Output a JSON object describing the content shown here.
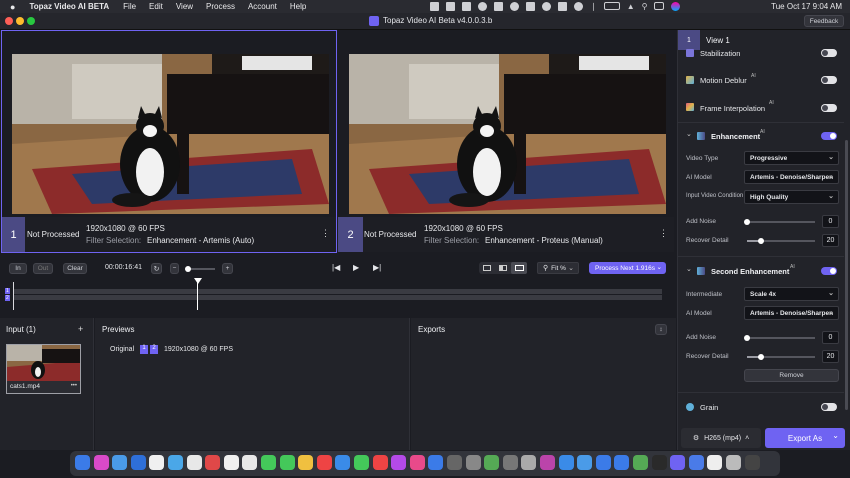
{
  "menubar": {
    "app_name": "Topaz Video AI BETA",
    "items": [
      "File",
      "Edit",
      "View",
      "Process",
      "Account",
      "Help"
    ],
    "clock": "Tue Oct 17  9:04 AM"
  },
  "window": {
    "title": "Topaz Video AI Beta  v4.0.0.3.b",
    "feedback_label": "Feedback"
  },
  "views": [
    {
      "number": "1",
      "status": "Not Processed",
      "resolution": "1920x1080 @ 60 FPS",
      "filter_label": "Filter Selection:",
      "filter_value": "Enhancement - Artemis (Auto)"
    },
    {
      "number": "2",
      "status": "Not Processed",
      "resolution": "1920x1080 @ 60 FPS",
      "filter_label": "Filter Selection:",
      "filter_value": "Enhancement - Proteus (Manual)"
    }
  ],
  "transport": {
    "in_label": "In",
    "out_label": "Out",
    "clear_label": "Clear",
    "timecode": "00:00:16:41",
    "fit_label": "Fit %",
    "process_label": "Process Next 1.916s"
  },
  "timeline": {
    "track1": "1",
    "track2": "2"
  },
  "input_panel": {
    "title": "Input (1)",
    "add_label": "+",
    "file_name": "cats1.mp4",
    "file_more": "•••"
  },
  "previews_panel": {
    "title": "Previews",
    "row_label": "Original",
    "badge1": "1",
    "badge2": "2",
    "row_info": "1920x1080 @ 60 FPS"
  },
  "exports_panel": {
    "title": "Exports",
    "sort_label": "↕"
  },
  "sidebar": {
    "view_tab_number": "1",
    "view_tab_label": "View 1",
    "stabilization": "Stabilization",
    "motion_deblur": "Motion Deblur",
    "frame_interpolation": "Frame Interpolation",
    "ai_sup": "AI",
    "enhancement": {
      "title": "Enhancement",
      "video_type_label": "Video Type",
      "video_type": "Progressive",
      "ai_model_label": "AI Model",
      "ai_model": "Artemis - Denoise/Sharpen",
      "condition_label": "Input Video Condition",
      "condition": "High Quality",
      "add_noise_label": "Add Noise",
      "add_noise": "0",
      "add_noise_fraction": 0,
      "recover_detail_label": "Recover Detail",
      "recover_detail": "20",
      "recover_detail_fraction": 0.2
    },
    "second_enhancement": {
      "title": "Second Enhancement",
      "intermediate_label": "Intermediate",
      "intermediate": "Scale 4x",
      "ai_model_label": "AI Model",
      "ai_model": "Artemis - Denoise/Sharpen",
      "add_noise_label": "Add Noise",
      "add_noise": "0",
      "add_noise_fraction": 0,
      "recover_detail_label": "Recover Detail",
      "recover_detail": "20",
      "recover_detail_fraction": 0.2,
      "remove_label": "Remove"
    },
    "grain": "Grain",
    "export_format": "H265 (mp4)",
    "export_as": "Export As"
  },
  "colors": {
    "accent": "#6f63f2",
    "background": "#1b1c22",
    "panel": "#222329"
  }
}
